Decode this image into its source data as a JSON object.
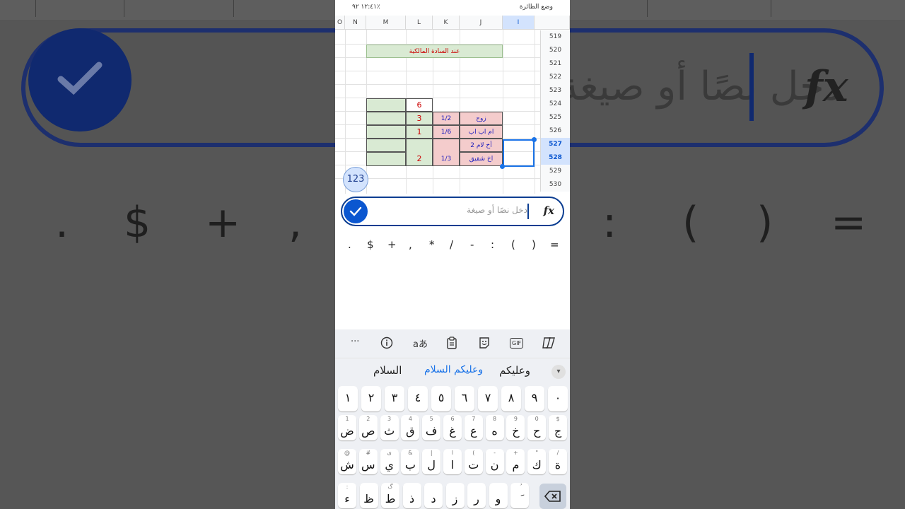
{
  "status": {
    "left": "١٢:٤١ ٩٢٪",
    "right": "وضع الطائرة"
  },
  "columns": [
    "O",
    "N",
    "M",
    "L",
    "K",
    "J",
    "I"
  ],
  "rows": [
    "519",
    "520",
    "521",
    "522",
    "523",
    "524",
    "525",
    "526",
    "527",
    "528",
    "529",
    "530"
  ],
  "cells": {
    "m520_label": "عند السادة المالكية",
    "l524": "6",
    "l525": "3",
    "l526": "1",
    "l528": "2",
    "k525": "1/2",
    "k526": "1/6",
    "k528": "1/3",
    "j525": "زوج",
    "j526": "ام اب اب",
    "j527": "2 أخ لام",
    "j528": "اخ شقيق"
  },
  "badge": "123",
  "formula_bar": {
    "placeholder": "دخل نصًا أو صيغة",
    "fx": "fx"
  },
  "symbols": [
    ".",
    "$",
    "+",
    ",",
    "*",
    "/",
    "-",
    ":",
    "(",
    ")",
    "="
  ],
  "toolbar": {
    "more": "···",
    "translate": "aあ",
    "gif": "GIF"
  },
  "suggestions": {
    "left": "السلام",
    "middle": "وعليكم السلام",
    "right": "وعليكم"
  },
  "keyboard": {
    "numbers": [
      "١",
      "٢",
      "٣",
      "٤",
      "٥",
      "٦",
      "٧",
      "٨",
      "٩",
      "٠"
    ],
    "row1": [
      {
        "m": "ض",
        "s": "1"
      },
      {
        "m": "ص",
        "s": "2"
      },
      {
        "m": "ث",
        "s": "3"
      },
      {
        "m": "ق",
        "s": "4"
      },
      {
        "m": "ف",
        "s": "5"
      },
      {
        "m": "غ",
        "s": "6"
      },
      {
        "m": "ع",
        "s": "7"
      },
      {
        "m": "ه",
        "s": "8"
      },
      {
        "m": "خ",
        "s": "9"
      },
      {
        "m": "ح",
        "s": "0"
      },
      {
        "m": "ج",
        "s": "$"
      }
    ],
    "row2": [
      {
        "m": "ش",
        "s": "@"
      },
      {
        "m": "س",
        "s": "#"
      },
      {
        "m": "ي",
        "s": "ى"
      },
      {
        "m": "ب",
        "s": "&"
      },
      {
        "m": "ل",
        "s": "|"
      },
      {
        "m": "ا",
        "s": "ا"
      },
      {
        "m": "ت",
        "s": "("
      },
      {
        "m": "ن",
        "s": "-"
      },
      {
        "m": "م",
        "s": "+"
      },
      {
        "m": "ك",
        "s": "\""
      },
      {
        "m": "ة",
        "s": "/"
      }
    ],
    "row3": [
      {
        "m": "ء",
        "s": ":"
      },
      {
        "m": "ظ",
        "s": ""
      },
      {
        "m": "ط",
        "s": "گ"
      },
      {
        "m": "ذ",
        "s": ""
      },
      {
        "m": "د",
        "s": ""
      },
      {
        "m": "ز",
        "s": ""
      },
      {
        "m": "ر",
        "s": ""
      },
      {
        "m": "و",
        "s": ""
      },
      {
        "m": "َ",
        "s": "ُ"
      }
    ]
  },
  "colors": {
    "accent": "#0b57d0",
    "green_cell": "#d9ead3",
    "pink_cell": "#f4cccc",
    "red_text": "#cc0000",
    "blue_text": "#1e1ebd"
  }
}
